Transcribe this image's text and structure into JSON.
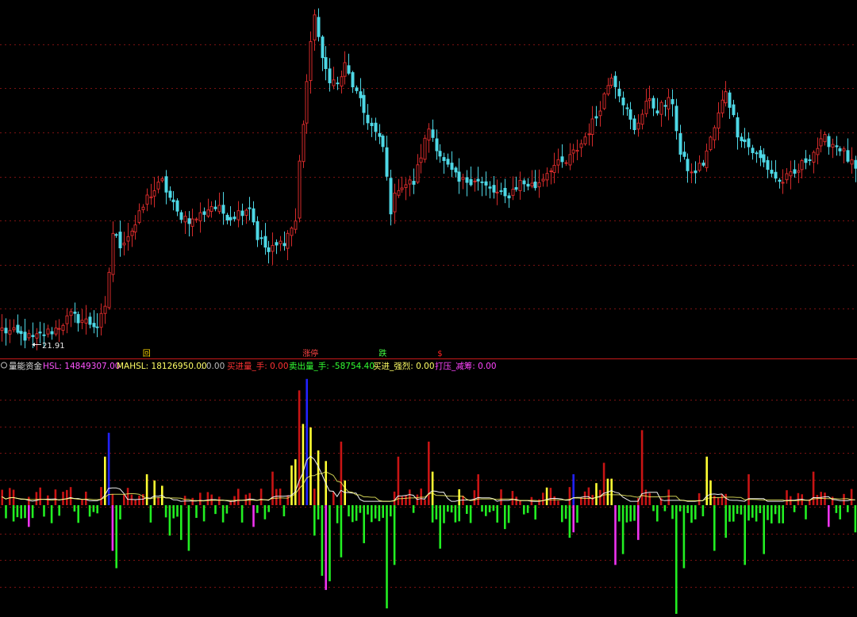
{
  "colors": {
    "background": "#000000",
    "grid": "#7a1212",
    "divider": "#c81a1a",
    "candle_up": "#d42a2a",
    "candle_down": "#4ed8e6",
    "vol_up": "#c81414",
    "vol_up_strong": "#ffff33",
    "vol_down": "#22ee22",
    "vol_down_strong": "#ee33ee",
    "vol_spike": "#2222ff",
    "avg_line": "#f0f0f0",
    "low_label": "#e8e8e8",
    "hsl_label": "#ff55ff",
    "mahsl_label": "#ffff66",
    "buy_label": "#ff3333",
    "sell_label": "#33ff33",
    "strong_label": "#ffff66",
    "press_label": "#ff44ff",
    "marker_hui": "#ffd700",
    "marker_zhang": "#ff4444",
    "marker_die": "#44ff44",
    "marker_dollar": "#ff2222"
  },
  "price_panel": {
    "low_marker": "21.91",
    "icon": "arrow-left-icon"
  },
  "signal_markers": [
    {
      "text": "回",
      "index": 38,
      "color_key": "marker_hui"
    },
    {
      "text": "涨停",
      "index": 81,
      "color_key": "marker_zhang"
    },
    {
      "text": "跌",
      "index": 100,
      "color_key": "marker_die"
    },
    {
      "text": "$",
      "index": 115,
      "color_key": "marker_dollar"
    }
  ],
  "indicator_header": {
    "name": "量能资金",
    "hsl": "HSL: 14849307.00",
    "mahsl": "MAHSL: 18126950.00",
    "sep": ": 0.00",
    "buy": "买进量_手: 0.00",
    "sell": "卖出量_手: -58754.40",
    "strong": "买进_强烈: 0.00",
    "press": "打压_减筹: 0.00"
  },
  "chart_data": [
    {
      "type": "candlestick",
      "title": "",
      "n": 225,
      "ylim": [
        20.5,
        66.0
      ],
      "low_annotation": {
        "index": 8,
        "value": 21.91
      },
      "close_anchors": [
        [
          0,
          23.5
        ],
        [
          8,
          22.3
        ],
        [
          14,
          23.6
        ],
        [
          18,
          25.3
        ],
        [
          25,
          24.0
        ],
        [
          27,
          26.0
        ],
        [
          29,
          36.0
        ],
        [
          31,
          34.5
        ],
        [
          35,
          37.0
        ],
        [
          38,
          40.5
        ],
        [
          42,
          42.5
        ],
        [
          46,
          38.5
        ],
        [
          50,
          37.5
        ],
        [
          55,
          39.5
        ],
        [
          60,
          38.0
        ],
        [
          65,
          39.5
        ],
        [
          67,
          35.5
        ],
        [
          70,
          33.5
        ],
        [
          74,
          35.0
        ],
        [
          77,
          37.5
        ],
        [
          78,
          45.0
        ],
        [
          80,
          55.5
        ],
        [
          82,
          64.5
        ],
        [
          84,
          58.0
        ],
        [
          86,
          56.0
        ],
        [
          88,
          55.0
        ],
        [
          90,
          57.5
        ],
        [
          95,
          51.5
        ],
        [
          100,
          47.0
        ],
        [
          102,
          39.0
        ],
        [
          104,
          42.0
        ],
        [
          108,
          42.5
        ],
        [
          112,
          49.5
        ],
        [
          116,
          45.0
        ],
        [
          120,
          42.5
        ],
        [
          124,
          43.0
        ],
        [
          128,
          41.5
        ],
        [
          132,
          40.5
        ],
        [
          136,
          42.5
        ],
        [
          140,
          42.0
        ],
        [
          144,
          44.5
        ],
        [
          148,
          45.0
        ],
        [
          152,
          47.5
        ],
        [
          156,
          51.0
        ],
        [
          160,
          56.5
        ],
        [
          163,
          53.0
        ],
        [
          166,
          49.0
        ],
        [
          169,
          53.0
        ],
        [
          172,
          52.0
        ],
        [
          176,
          53.0
        ],
        [
          178,
          46.0
        ],
        [
          181,
          43.5
        ],
        [
          184,
          45.0
        ],
        [
          187,
          49.5
        ],
        [
          190,
          54.5
        ],
        [
          193,
          49.0
        ],
        [
          197,
          46.5
        ],
        [
          200,
          45.0
        ],
        [
          204,
          42.5
        ],
        [
          208,
          43.5
        ],
        [
          212,
          46.0
        ],
        [
          216,
          48.0
        ],
        [
          220,
          47.0
        ],
        [
          224,
          44.0
        ]
      ]
    },
    {
      "type": "bar",
      "title": "量能资金",
      "series": [
        {
          "name": "HSL",
          "last": 14849307.0
        },
        {
          "name": "MAHSL",
          "last": 18126950.0
        },
        {
          "name": "买进量_手",
          "last": 0.0
        },
        {
          "name": "卖出量_手",
          "last": -58754.4
        },
        {
          "name": "买进_强烈",
          "last": 0.0
        },
        {
          "name": "打压_减筹",
          "last": 0.0
        }
      ],
      "ylim": [
        -1.0,
        1.5
      ],
      "spikes_up": [
        [
          27,
          0.55,
          "strong"
        ],
        [
          28,
          0.82,
          "spike"
        ],
        [
          38,
          0.35,
          "strong"
        ],
        [
          40,
          0.28,
          "strong"
        ],
        [
          42,
          0.22,
          "strong"
        ],
        [
          71,
          0.38,
          "up"
        ],
        [
          76,
          0.45,
          "strong"
        ],
        [
          77,
          0.52,
          "strong"
        ],
        [
          78,
          1.3,
          "up"
        ],
        [
          79,
          0.92,
          "strong"
        ],
        [
          80,
          1.43,
          "spike"
        ],
        [
          81,
          0.88,
          "strong"
        ],
        [
          83,
          0.62,
          "strong"
        ],
        [
          85,
          0.5,
          "strong"
        ],
        [
          89,
          0.72,
          "up"
        ],
        [
          90,
          0.28,
          "strong"
        ],
        [
          104,
          0.55,
          "up"
        ],
        [
          112,
          0.72,
          "up"
        ],
        [
          113,
          0.38,
          "strong"
        ],
        [
          120,
          0.18,
          "strong"
        ],
        [
          125,
          0.35,
          "up"
        ],
        [
          143,
          0.2,
          "strong"
        ],
        [
          150,
          0.35,
          "spike"
        ],
        [
          156,
          0.25,
          "strong"
        ],
        [
          158,
          0.48,
          "up"
        ],
        [
          159,
          0.3,
          "strong"
        ],
        [
          160,
          0.3,
          "strong"
        ],
        [
          168,
          0.85,
          "up"
        ],
        [
          185,
          0.55,
          "strong"
        ],
        [
          186,
          0.28,
          "strong"
        ],
        [
          196,
          0.35,
          "up"
        ],
        [
          213,
          0.38,
          "up"
        ]
      ],
      "spikes_down": [
        [
          3,
          -0.15,
          "down"
        ],
        [
          7,
          -0.2,
          "strong"
        ],
        [
          30,
          -0.58,
          "down"
        ],
        [
          29,
          -0.42,
          "strong"
        ],
        [
          44,
          -0.28,
          "down"
        ],
        [
          47,
          -0.32,
          "down"
        ],
        [
          49,
          -0.42,
          "down"
        ],
        [
          66,
          -0.2,
          "strong"
        ],
        [
          82,
          -0.28,
          "down"
        ],
        [
          84,
          -0.65,
          "down"
        ],
        [
          85,
          -0.78,
          "strong"
        ],
        [
          86,
          -0.7,
          "down"
        ],
        [
          89,
          -0.48,
          "down"
        ],
        [
          95,
          -0.35,
          "down"
        ],
        [
          101,
          -0.95,
          "down"
        ],
        [
          103,
          -0.55,
          "down"
        ],
        [
          115,
          -0.4,
          "down"
        ],
        [
          132,
          -0.22,
          "down"
        ],
        [
          149,
          -0.3,
          "down"
        ],
        [
          150,
          -0.25,
          "strong"
        ],
        [
          161,
          -0.55,
          "strong"
        ],
        [
          163,
          -0.45,
          "down"
        ],
        [
          167,
          -0.32,
          "strong"
        ],
        [
          177,
          -1.18,
          "down"
        ],
        [
          179,
          -0.58,
          "down"
        ],
        [
          187,
          -0.42,
          "down"
        ],
        [
          190,
          -0.3,
          "down"
        ],
        [
          195,
          -0.55,
          "down"
        ],
        [
          200,
          -0.45,
          "down"
        ],
        [
          217,
          -0.2,
          "strong"
        ],
        [
          224,
          -0.25,
          "down"
        ]
      ]
    }
  ]
}
